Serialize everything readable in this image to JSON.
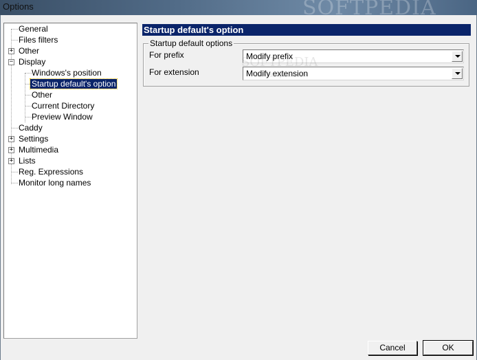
{
  "window": {
    "title": "Options",
    "watermark": "SOFTPEDIA"
  },
  "tree": {
    "items": [
      {
        "label": "General"
      },
      {
        "label": "Files filters"
      },
      {
        "label": "Other",
        "expander": "+"
      },
      {
        "label": "Display",
        "expander": "−"
      },
      {
        "label": "Windows's position"
      },
      {
        "label": "Startup default's option",
        "selected": true
      },
      {
        "label": "Other"
      },
      {
        "label": "Current Directory"
      },
      {
        "label": "Preview Window"
      },
      {
        "label": "Caddy"
      },
      {
        "label": "Settings",
        "expander": "+"
      },
      {
        "label": "Multimedia",
        "expander": "+"
      },
      {
        "label": "Lists",
        "expander": "+"
      },
      {
        "label": "Reg. Expressions"
      },
      {
        "label": "Monitor long names"
      }
    ]
  },
  "panel": {
    "header": "Startup default's option",
    "group_title": "Startup default options",
    "prefix_label": "For prefix",
    "prefix_value": "Modify prefix",
    "extension_label": "For extension",
    "extension_value": "Modify extension",
    "watermark": "SOFTPEDIA",
    "watermark_small": "www.softpedia.com"
  },
  "buttons": {
    "cancel": "Cancel",
    "ok": "OK"
  }
}
